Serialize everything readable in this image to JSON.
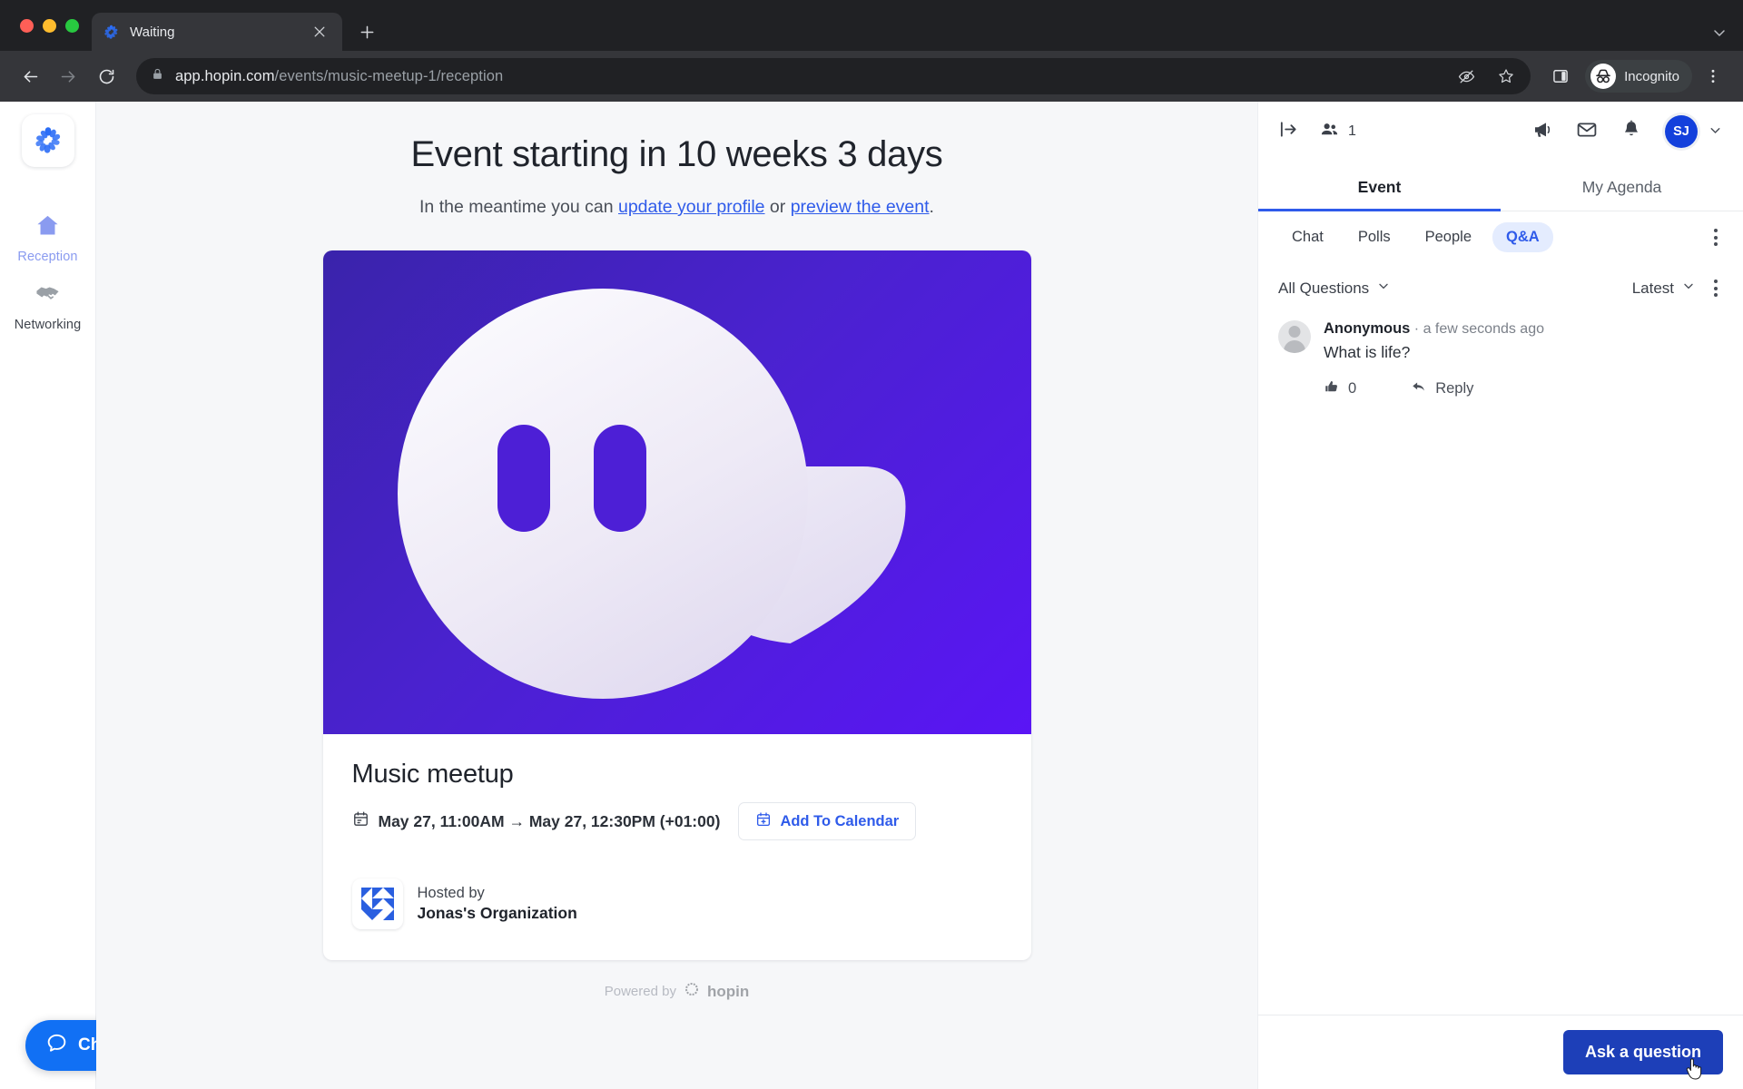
{
  "browser": {
    "tab": {
      "title": "Waiting",
      "favicon": "hopin-logo-icon",
      "close_icon": "close-icon"
    },
    "new_tab_icon": "plus-icon",
    "tab_list_icon": "chevron-down-icon",
    "nav": {
      "back_icon": "back-arrow-icon",
      "forward_icon": "forward-arrow-icon",
      "reload_icon": "reload-icon"
    },
    "omnibox": {
      "lock_icon": "lock-icon",
      "url_host": "app.hopin.com",
      "url_path": "/events/music-meetup-1/reception",
      "third_party_cookies_icon": "eye-slash-icon",
      "bookmark_icon": "star-icon"
    },
    "side_panel_icon": "side-panel-icon",
    "incognito": {
      "label": "Incognito",
      "icon": "incognito-icon"
    },
    "menu_icon": "kebab-menu-icon"
  },
  "rail": {
    "brand_icon": "hopin-logo-icon",
    "items": [
      {
        "label": "Reception",
        "icon": "home-icon",
        "active": true
      },
      {
        "label": "Networking",
        "icon": "handshake-icon",
        "active": false
      }
    ]
  },
  "main": {
    "headline": "Event starting in 10 weeks 3 days",
    "subline_prefix": "In the meantime you can ",
    "link_profile": "update your profile",
    "subline_or": " or ",
    "link_preview": "preview the event",
    "subline_suffix": ".",
    "banner": {
      "icon": "ghost-illustration",
      "background_from": "#3a23ab",
      "background_to": "#5a15f5",
      "ghost_color": "#f1eefa"
    },
    "event": {
      "title": "Music meetup",
      "calendar_icon": "calendar-icon",
      "schedule": "May 27, 11:00AM → May 27, 12:30PM (+01:00)",
      "add_to_calendar": {
        "label": "Add To Calendar",
        "icon": "calendar-plus-icon"
      },
      "hosted_by_label": "Hosted by",
      "host_name": "Jonas's Organization",
      "host_logo_icon": "organization-logo-icon"
    },
    "powered": {
      "prefix": "Powered by",
      "brand": "hopin",
      "icon": "hopin-logo-icon"
    },
    "chat_fab": {
      "label": "Chat",
      "icon": "chat-bubble-icon",
      "color": "#1170f4"
    }
  },
  "panel": {
    "header": {
      "collapse_icon": "collapse-panel-icon",
      "people_icon": "people-icon",
      "people_count": "1",
      "announcement_icon": "megaphone-icon",
      "mail_icon": "envelope-icon",
      "bell_icon": "bell-icon",
      "avatar_initials": "SJ",
      "avatar_color": "#1340dc",
      "avatar_chevron_icon": "chevron-down-icon"
    },
    "tabs": [
      {
        "label": "Event",
        "active": true
      },
      {
        "label": "My Agenda",
        "active": false
      }
    ],
    "subtabs": [
      {
        "label": "Chat",
        "active": false
      },
      {
        "label": "Polls",
        "active": false
      },
      {
        "label": "People",
        "active": false
      },
      {
        "label": "Q&A",
        "active": true
      }
    ],
    "subtabs_menu_icon": "kebab-menu-icon",
    "filter": {
      "questions_filter": "All Questions",
      "questions_filter_icon": "chevron-down-icon",
      "sort": "Latest",
      "sort_icon": "chevron-down-icon",
      "menu_icon": "kebab-menu-icon"
    },
    "questions": [
      {
        "author": "Anonymous",
        "separator": "·",
        "time": "a few seconds ago",
        "text": "What is life?",
        "like_icon": "thumbs-up-icon",
        "like_count": "0",
        "reply_icon": "reply-arrow-icon",
        "reply_label": "Reply",
        "avatar_icon": "default-avatar-icon"
      }
    ],
    "footer": {
      "ask_button": "Ask a question",
      "button_color": "#1d3fb8"
    }
  }
}
